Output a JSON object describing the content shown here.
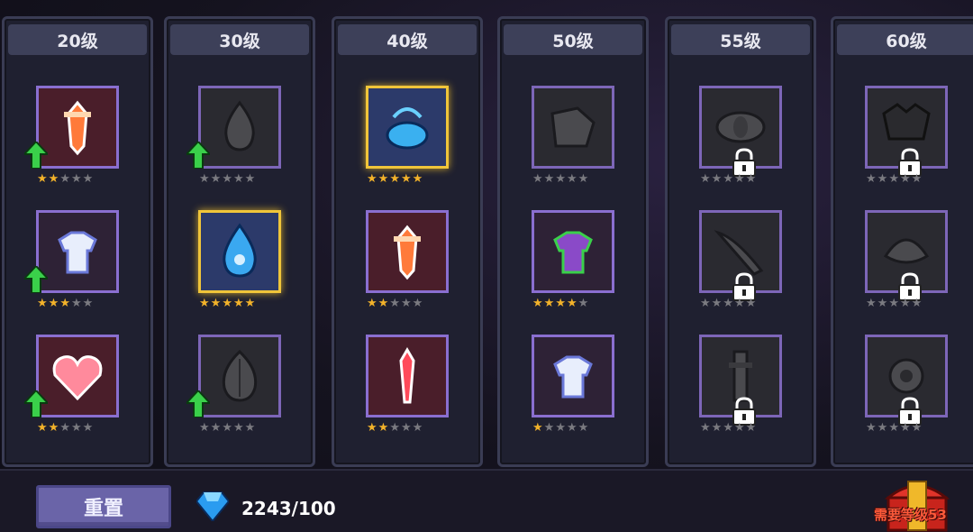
{
  "columns": [
    {
      "label": "20级",
      "items": [
        {
          "icon": "sword-red-icon",
          "stars": 2,
          "upgrade": true,
          "locked": false
        },
        {
          "icon": "armor-white-icon",
          "stars": 3,
          "upgrade": true,
          "locked": false
        },
        {
          "icon": "heart-icon",
          "stars": 2,
          "upgrade": true,
          "locked": false
        }
      ]
    },
    {
      "label": "30级",
      "items": [
        {
          "icon": "fire-drop-dark-icon",
          "stars": 0,
          "upgrade": true,
          "locked": false
        },
        {
          "icon": "water-drop-icon",
          "stars": 5,
          "upgrade": false,
          "locked": false
        },
        {
          "icon": "leaf-dark-icon",
          "stars": 0,
          "upgrade": true,
          "locked": false
        }
      ]
    },
    {
      "label": "40级",
      "items": [
        {
          "icon": "blue-potion-icon",
          "stars": 5,
          "upgrade": false,
          "locked": false
        },
        {
          "icon": "sword-red-icon",
          "stars": 2,
          "upgrade": false,
          "locked": false
        },
        {
          "icon": "red-crystal-icon",
          "stars": 2,
          "upgrade": false,
          "locked": false
        }
      ]
    },
    {
      "label": "50级",
      "items": [
        {
          "icon": "dark-boot-icon",
          "stars": 0,
          "upgrade": false,
          "locked": false
        },
        {
          "icon": "purple-armor-icon",
          "stars": 4,
          "upgrade": false,
          "locked": false
        },
        {
          "icon": "armor-white-icon",
          "stars": 1,
          "upgrade": false,
          "locked": false
        }
      ]
    },
    {
      "label": "55级",
      "items": [
        {
          "icon": "dark-eye-icon",
          "stars": 0,
          "upgrade": false,
          "locked": true
        },
        {
          "icon": "dark-blade-icon",
          "stars": 0,
          "upgrade": false,
          "locked": true
        },
        {
          "icon": "dark-pillar-icon",
          "stars": 0,
          "upgrade": false,
          "locked": true
        }
      ]
    },
    {
      "label": "60级",
      "items": [
        {
          "icon": "dark-skull-icon",
          "stars": 0,
          "upgrade": false,
          "locked": true
        },
        {
          "icon": "dark-shell-icon",
          "stars": 0,
          "upgrade": false,
          "locked": true
        },
        {
          "icon": "dark-gear-icon",
          "stars": 0,
          "upgrade": false,
          "locked": true
        }
      ]
    }
  ],
  "bottom": {
    "reset_label": "重置",
    "gem_count": "2243/100",
    "need_level_label": "需要等级53"
  },
  "colors": {
    "star_on": "#f2b22a",
    "star_off": "#7a7a80",
    "frame": "#8a6fd0",
    "gold_frame": "#f0c53a",
    "upgrade_arrow": "#3ad04a"
  }
}
